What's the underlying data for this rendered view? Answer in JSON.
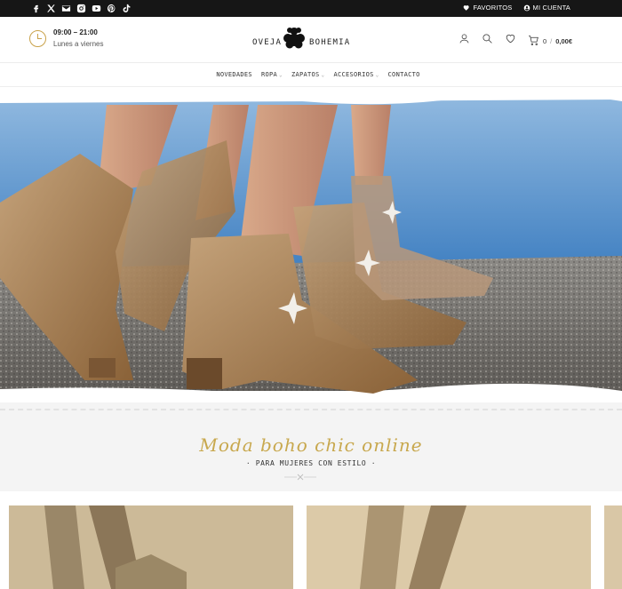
{
  "topbar": {
    "social_icons": [
      "facebook-icon",
      "x-icon",
      "mail-icon",
      "instagram-icon",
      "youtube-icon",
      "pinterest-icon",
      "tiktok-icon"
    ],
    "favoritos_label": "FAVORITOS",
    "cuenta_label": "MI CUENTA"
  },
  "header": {
    "hours": "09:00 – 21:00",
    "days": "Lunes a viernes",
    "logo_left": "OVEJA",
    "logo_right": "BOHEMIA",
    "cart_count": "0",
    "cart_sep": "/",
    "cart_total": "0,00€"
  },
  "nav": {
    "items": [
      {
        "label": "NOVEDADES"
      },
      {
        "label": "ROPA"
      },
      {
        "label": "ZAPATOS"
      },
      {
        "label": "ACCESORIOS"
      },
      {
        "label": "CONTACTO"
      }
    ]
  },
  "tagline": {
    "title": "Moda boho chic online",
    "subtitle": "· PARA MUJERES CON ESTILO ·"
  },
  "colors": {
    "accent_gold": "#c9a24a",
    "topbar_bg": "#161616",
    "section_bg": "#f4f4f4"
  }
}
